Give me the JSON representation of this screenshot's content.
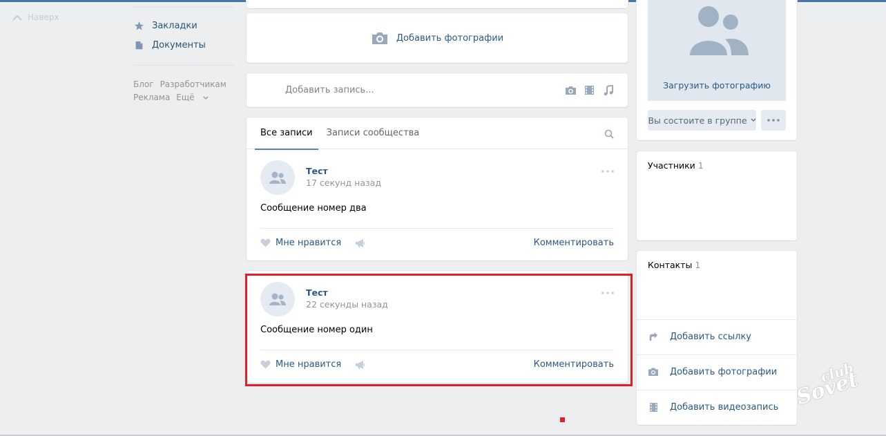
{
  "back_to_top": {
    "label": "Наверх"
  },
  "left_menu": {
    "items": [
      {
        "label": "Закладки",
        "icon": "star-icon"
      },
      {
        "label": "Документы",
        "icon": "document-icon"
      }
    ],
    "footer": [
      "Блог",
      "Разработчикам",
      "Реклама",
      "Ещё"
    ]
  },
  "photo_block": {
    "label": "Добавить фотографии"
  },
  "post_box": {
    "placeholder": "Добавить запись..."
  },
  "wall": {
    "tabs": [
      {
        "label": "Все записи",
        "active": true
      },
      {
        "label": "Записи сообщества",
        "active": false
      }
    ],
    "posts": [
      {
        "author": "Тест",
        "time": "17 секунд назад",
        "text": "Сообщение номер два",
        "like": "Мне нравится",
        "comment": "Комментировать"
      },
      {
        "author": "Тест",
        "time": "22 секунды назад",
        "text": "Сообщение номер один",
        "like": "Мне нравится",
        "comment": "Комментировать"
      }
    ]
  },
  "right": {
    "cover_label": "Загрузить фотографию",
    "member_button": "Вы состоите в группе",
    "members": {
      "title": "Участники",
      "count": "1"
    },
    "contacts": {
      "title": "Контакты",
      "count": "1"
    },
    "actions": [
      {
        "label": "Добавить ссылку",
        "icon": "link-arrow-icon"
      },
      {
        "label": "Добавить фотографии",
        "icon": "camera-icon"
      },
      {
        "label": "Добавить видеозапись",
        "icon": "film-icon"
      }
    ]
  },
  "watermark": {
    "line1": "club",
    "line2": "Sovet"
  },
  "colors": {
    "accent": "#5181b8",
    "link": "#2a5885",
    "highlight": "#e31e24",
    "background": "#edeef0"
  }
}
